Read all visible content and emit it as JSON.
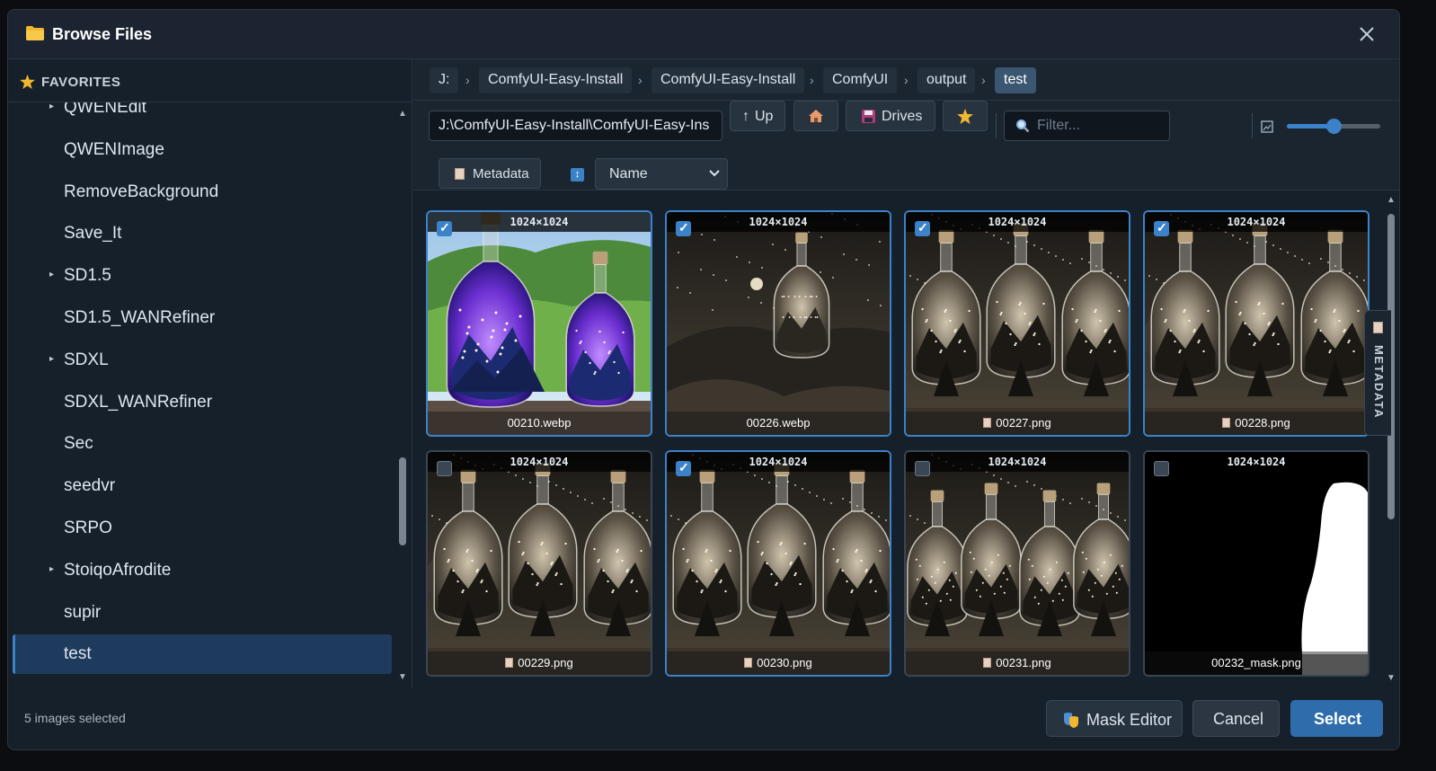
{
  "dialog": {
    "title": "Browse Files",
    "close_icon": "close-icon"
  },
  "sidebar": {
    "favorites_label": "FAVORITES",
    "items": [
      {
        "label": "QWENEdit",
        "expandable": true
      },
      {
        "label": "QWENImage",
        "expandable": false
      },
      {
        "label": "RemoveBackground",
        "expandable": false
      },
      {
        "label": "Save_It",
        "expandable": false
      },
      {
        "label": "SD1.5",
        "expandable": true
      },
      {
        "label": "SD1.5_WANRefiner",
        "expandable": false
      },
      {
        "label": "SDXL",
        "expandable": true
      },
      {
        "label": "SDXL_WANRefiner",
        "expandable": false
      },
      {
        "label": "Sec",
        "expandable": false
      },
      {
        "label": "seedvr",
        "expandable": false
      },
      {
        "label": "SRPO",
        "expandable": false
      },
      {
        "label": "StoiqoAfrodite",
        "expandable": true
      },
      {
        "label": "supir",
        "expandable": false
      },
      {
        "label": "test",
        "expandable": false,
        "selected": true
      }
    ]
  },
  "breadcrumb": [
    "J:",
    "ComfyUI-Easy-Install",
    "ComfyUI-Easy-Install",
    "ComfyUI",
    "output",
    "test"
  ],
  "toolbar": {
    "path_value": "J:\\ComfyUI-Easy-Install\\ComfyUI-Easy-Ins",
    "up_label": "Up",
    "drives_label": "Drives",
    "filter_placeholder": "Filter...",
    "metadata_label": "Metadata",
    "sort_value": "Name",
    "zoom_level": 0.5
  },
  "files": [
    {
      "name": "00210.webp",
      "dims": "1024×1024",
      "checked": true,
      "has_meta": false,
      "scene": "green"
    },
    {
      "name": "00226.webp",
      "dims": "1024×1024",
      "checked": true,
      "has_meta": false,
      "scene": "sepia1"
    },
    {
      "name": "00227.png",
      "dims": "1024×1024",
      "checked": true,
      "has_meta": true,
      "scene": "sepia3"
    },
    {
      "name": "00228.png",
      "dims": "1024×1024",
      "checked": true,
      "has_meta": true,
      "scene": "sepia3b"
    },
    {
      "name": "00229.png",
      "dims": "1024×1024",
      "checked": false,
      "has_meta": true,
      "scene": "sepia3b"
    },
    {
      "name": "00230.png",
      "dims": "1024×1024",
      "checked": true,
      "has_meta": true,
      "scene": "sepia3"
    },
    {
      "name": "00231.png",
      "dims": "1024×1024",
      "checked": false,
      "has_meta": true,
      "scene": "sepia4"
    },
    {
      "name": "00232_mask.png",
      "dims": "1024×1024",
      "checked": false,
      "has_meta": false,
      "scene": "mask"
    }
  ],
  "metadata_tab_label": "METADATA",
  "status": {
    "selected_text": "5 images selected"
  },
  "footer": {
    "mask_editor_label": "Mask Editor",
    "cancel_label": "Cancel",
    "select_label": "Select"
  },
  "colors": {
    "accent": "#3b82c8",
    "background": "#16202b",
    "selected_item": "#1e3a5c"
  }
}
